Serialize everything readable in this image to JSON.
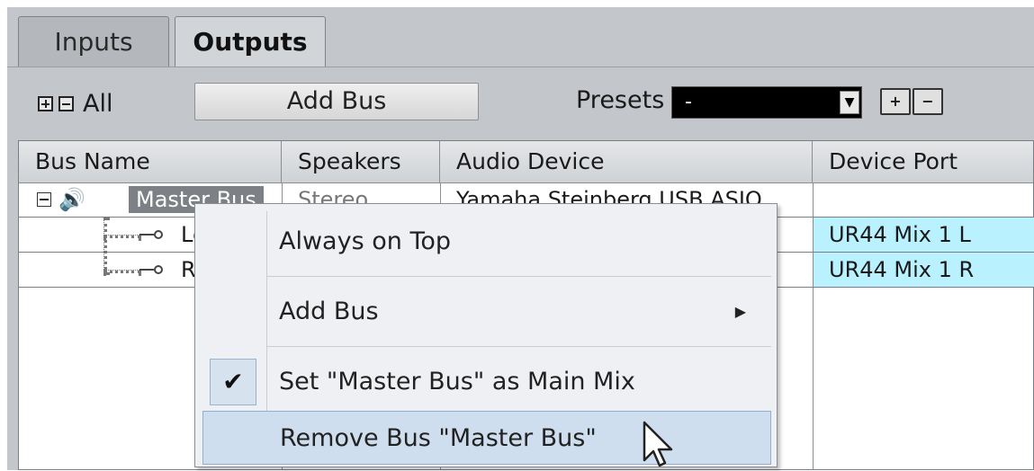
{
  "tabs": [
    {
      "label": "Inputs",
      "active": false
    },
    {
      "label": "Outputs",
      "active": true
    }
  ],
  "toolbar": {
    "all_label": "All",
    "add_bus_label": "Add Bus",
    "presets_label": "Presets",
    "presets_value": "-"
  },
  "table": {
    "headers": [
      "Bus Name",
      "Speakers",
      "Audio Device",
      "Device Port"
    ],
    "bus": {
      "name": "Master Bus",
      "speakers": "Stereo",
      "audio_device": "Yamaha Steinberg USB ASIO",
      "device_port": ""
    },
    "channels": [
      {
        "label": "Le",
        "device_port": "UR44 Mix 1 L"
      },
      {
        "label": "R",
        "device_port": "UR44 Mix 1 R"
      }
    ]
  },
  "context_menu": {
    "items": [
      {
        "label": "Always on Top"
      },
      {
        "label": "Add Bus",
        "has_submenu": true
      },
      {
        "label": "Set \"Master Bus\" as Main Mix",
        "checked": true
      },
      {
        "label": "Remove Bus \"Master Bus\"",
        "hovered": true
      }
    ]
  },
  "colors": {
    "port_highlight": "#b9f1ff",
    "selection": "#7d8185",
    "menu_hover": "#cfdeee"
  }
}
